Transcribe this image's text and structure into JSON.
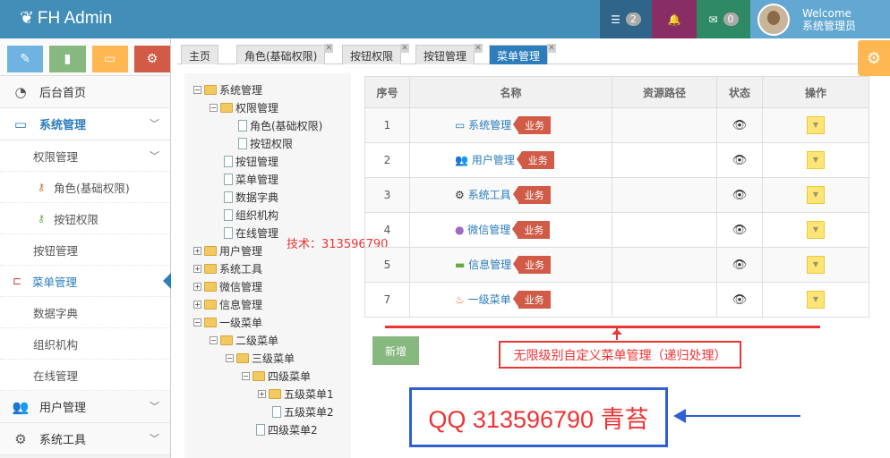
{
  "app": {
    "title": "FH Admin"
  },
  "topbar": {
    "tasks_count": "2",
    "mail_count": "0",
    "welcome": "Welcome",
    "username": "系统管理员"
  },
  "sidebar": {
    "items": [
      {
        "label": "后台首页"
      },
      {
        "label": "系统管理"
      },
      {
        "label": "权限管理"
      },
      {
        "label": "角色(基础权限)"
      },
      {
        "label": "按钮权限"
      },
      {
        "label": "按钮管理"
      },
      {
        "label": "菜单管理"
      },
      {
        "label": "数据字典"
      },
      {
        "label": "组织机构"
      },
      {
        "label": "在线管理"
      },
      {
        "label": "用户管理"
      },
      {
        "label": "系统工具"
      }
    ]
  },
  "tabs": [
    "主页",
    "角色(基础权限)",
    "按钮权限",
    "按钮管理",
    "菜单管理"
  ],
  "tree": {
    "nodes": [
      "系统管理",
      "权限管理",
      "角色(基础权限)",
      "按钮权限",
      "按钮管理",
      "菜单管理",
      "数据字典",
      "组织机构",
      "在线管理",
      "用户管理",
      "系统工具",
      "微信管理",
      "信息管理",
      "一级菜单",
      "二级菜单",
      "三级菜单",
      "四级菜单",
      "五级菜单1",
      "五级菜单2",
      "四级菜单2"
    ]
  },
  "watermark": "技术：313596790",
  "table": {
    "headers": [
      "序号",
      "名称",
      "资源路径",
      "状态",
      "操作"
    ],
    "rows": [
      {
        "no": "1",
        "name": "系统管理",
        "tag": "业务"
      },
      {
        "no": "2",
        "name": "用户管理",
        "tag": "业务"
      },
      {
        "no": "3",
        "name": "系统工具",
        "tag": "业务"
      },
      {
        "no": "4",
        "name": "微信管理",
        "tag": "业务"
      },
      {
        "no": "5",
        "name": "信息管理",
        "tag": "业务"
      },
      {
        "no": "7",
        "name": "一级菜单",
        "tag": "业务"
      }
    ]
  },
  "add_button": "新增",
  "annotation": "无限级别自定义菜单管理（递归处理）",
  "qq_box": "QQ 313596790 青苔",
  "colors": {
    "header_blue": "#438eb9",
    "accent_blue": "#2b7dbc",
    "tag_red": "#d15b47",
    "add_green": "#87b87f"
  }
}
